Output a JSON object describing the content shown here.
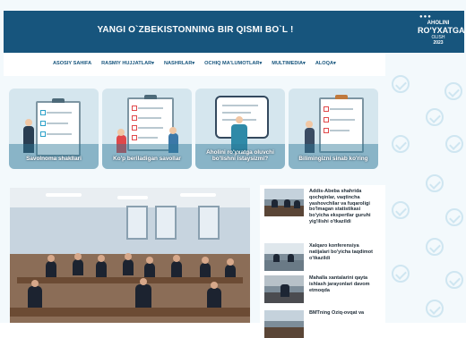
{
  "header": {
    "title": "YANGI O`ZBEKISTONNING BIR QISMI BO`L !",
    "logo": {
      "line1": "AHOLINI",
      "line2": "RO'YXATGA",
      "line3": "OLISH",
      "line4": "2023"
    }
  },
  "nav": {
    "items": [
      {
        "label": "ASOSIY SAHIFA"
      },
      {
        "label": "RASMIY HUJJATLAR"
      },
      {
        "label": "NASHRLAR"
      },
      {
        "label": "OCHIQ MA'LUMOTLAR"
      },
      {
        "label": "MULTIMEDIA"
      },
      {
        "label": "ALOQA"
      }
    ]
  },
  "cards": [
    {
      "label": "Savolnoma shakllari"
    },
    {
      "label": "Ko'p beriladigan savollar"
    },
    {
      "label": "Aholini ro'yxatga oluvchi bo'lishni istaysizmi?"
    },
    {
      "label": "Bilimingizni sinab ko'ring"
    }
  ],
  "news": [
    {
      "text": "Addis-Abeba shahrida qochqinlar, vaqtincha yashovchilar va fuqaroligi bo'lmagan statistikasi bo'yicha ekspertlar guruhi yig'ilishi o'tkazildi"
    },
    {
      "text": "Xalqaro konferensiya natijalari bo'yicha taqdimot o'tkazildi"
    },
    {
      "text": "Mahalla xantalarini qayta ishlash jarayonlari davom etmoqda"
    },
    {
      "text": "BMTning Oziq-ovqat va"
    }
  ],
  "colors": {
    "header_bg": "#17557d",
    "nav_text": "#17557d",
    "page_bg": "#f3f9fc"
  }
}
